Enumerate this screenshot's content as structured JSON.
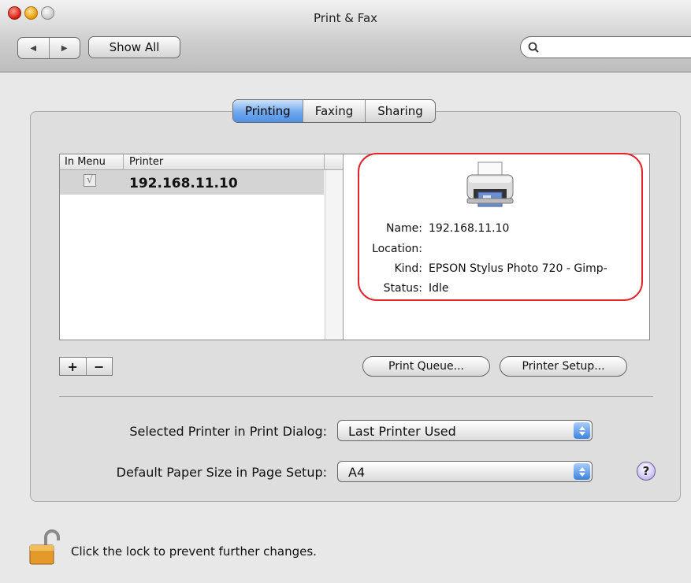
{
  "window": {
    "title": "Print & Fax"
  },
  "toolbar": {
    "back_glyph": "◀",
    "forward_glyph": "▶",
    "show_all_label": "Show All",
    "search_placeholder": ""
  },
  "tabs": [
    {
      "label": "Printing",
      "active": true
    },
    {
      "label": "Faxing",
      "active": false
    },
    {
      "label": "Sharing",
      "active": false
    }
  ],
  "printer_list": {
    "columns": [
      "In Menu",
      "Printer"
    ],
    "rows": [
      {
        "in_menu": true,
        "check_glyph": "√",
        "name": "192.168.11.10",
        "selected": true
      }
    ]
  },
  "printer_info": {
    "icon": "printer-icon",
    "name_label": "Name:",
    "name_value": "192.168.11.10",
    "location_label": "Location:",
    "location_value": "",
    "kind_label": "Kind:",
    "kind_value": "EPSON Stylus Photo 720 - Gimp-",
    "status_label": "Status:",
    "status_value": "Idle"
  },
  "list_controls": {
    "add": "+",
    "remove": "−"
  },
  "buttons": {
    "print_queue": "Print Queue...",
    "printer_setup": "Printer Setup..."
  },
  "settings": {
    "selected_printer_label": "Selected Printer in Print Dialog:",
    "selected_printer_value": "Last Printer Used",
    "paper_size_label": "Default Paper Size in Page Setup:",
    "paper_size_value": "A4"
  },
  "help_glyph": "?",
  "lock": {
    "icon": "lock-open-icon",
    "text": "Click the lock to prevent further changes."
  },
  "colors": {
    "highlight_border": "#e3242b",
    "active_tab": "#4e91e6",
    "selection_row": "#d4d4d4"
  }
}
